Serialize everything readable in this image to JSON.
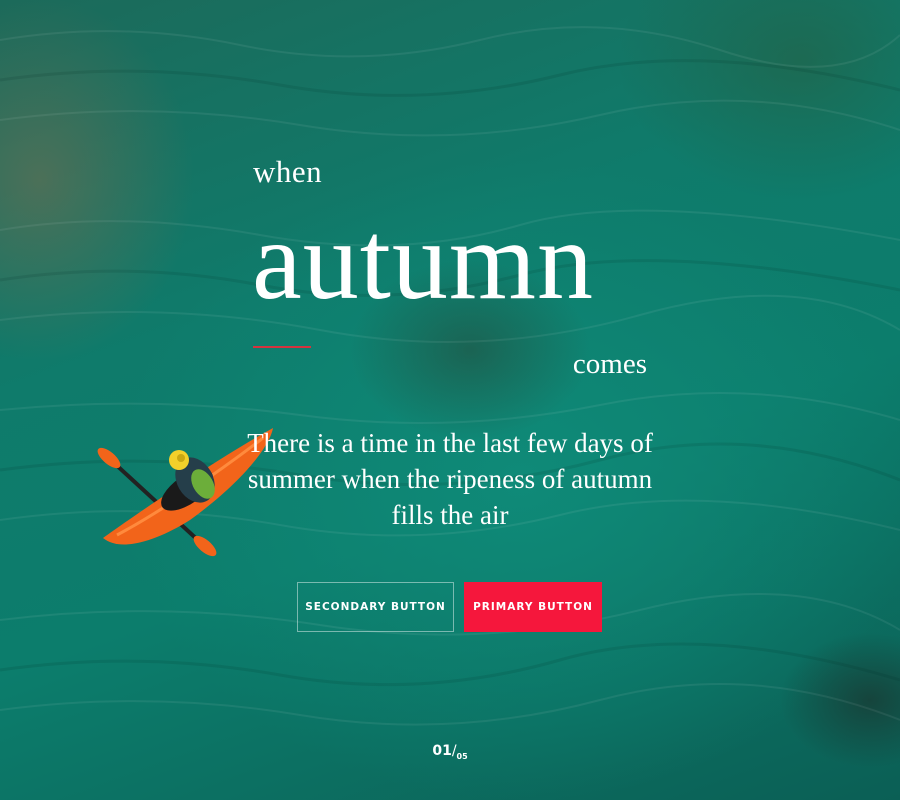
{
  "hero": {
    "eyebrow": "when",
    "headline": "autumn",
    "subhead": "comes",
    "tagline": "There is a time in the last few days of summer when the ripeness of autumn fills the air"
  },
  "buttons": {
    "secondary_label": "SECONDARY BUTTON",
    "primary_label": "PRIMARY BUTTON"
  },
  "pager": {
    "current": "01",
    "separator": "/",
    "total": "05"
  },
  "colors": {
    "accent": "#f5173c",
    "accent_line": "#d4333e",
    "water": "#0f7b6b"
  },
  "background": {
    "subject": "kayak-image"
  }
}
